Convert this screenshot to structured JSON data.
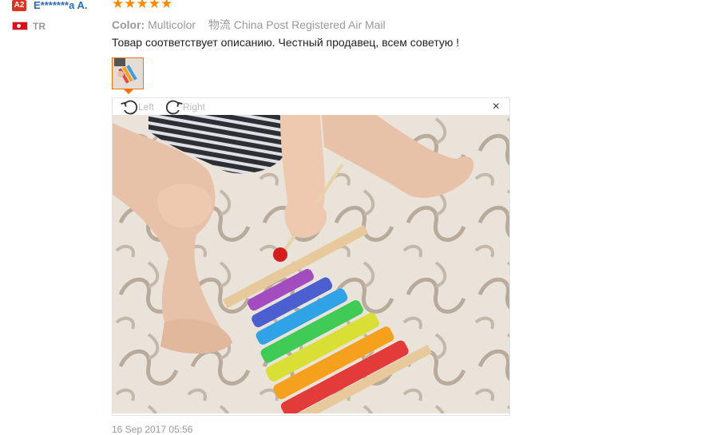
{
  "review": {
    "badge": "A2",
    "username": "E*******a A.",
    "rating": 5,
    "country": "TR",
    "color_label": "Color:",
    "color_value": "Multicolor",
    "shipping_prefix": "物流",
    "shipping": "China Post Registered Air Mail",
    "text": "Товар соответствует описанию. Честный продавец, всем советую !",
    "timestamp": "16 Sep 2017 05:56"
  },
  "viewer": {
    "rotate_left": "Left",
    "rotate_right": "Right",
    "close": "×"
  },
  "colors": {
    "accent": "#ff7000",
    "star": "#ff8a00",
    "username": "#2a6ab8",
    "badge": "#e0301e"
  }
}
